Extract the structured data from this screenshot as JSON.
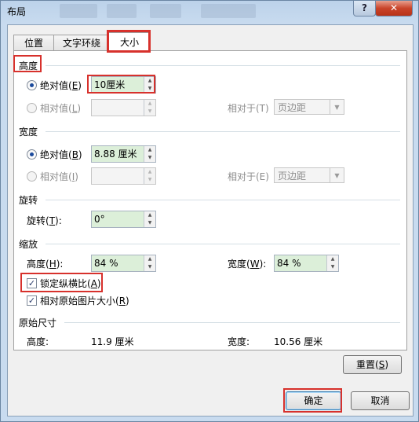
{
  "window": {
    "title": "布局",
    "help_label": "?",
    "close_label": "✕"
  },
  "tabs": [
    {
      "label": "位置",
      "active": false
    },
    {
      "label": "文字环绕",
      "active": false
    },
    {
      "label": "大小",
      "active": true
    }
  ],
  "height": {
    "section": "高度",
    "absolute_label": "绝对值(",
    "absolute_key": "E",
    "absolute_value": "10厘米",
    "relative_label": "相对值(",
    "relative_key": "L",
    "relative_to_label": "相对于(T)",
    "relative_to_value": "页边距"
  },
  "width": {
    "section": "宽度",
    "absolute_label": "绝对值(",
    "absolute_key": "B",
    "absolute_value": "8.88 厘米",
    "relative_label": "相对值(",
    "relative_key": "I",
    "relative_to_label": "相对于(E)",
    "relative_to_value": "页边距"
  },
  "rotate": {
    "section": "旋转",
    "label": "旋转(",
    "key": "T",
    "value": "0°"
  },
  "scale": {
    "section": "缩放",
    "height_label": "高度(",
    "height_key": "H",
    "height_value": "84 %",
    "width_label": "宽度(",
    "width_key": "W",
    "width_value": "84 %",
    "lock_label": "锁定纵横比(",
    "lock_key": "A",
    "lock_checked": true,
    "relative_label": "相对原始图片大小(",
    "relative_key": "R",
    "relative_checked": true
  },
  "original": {
    "section": "原始尺寸",
    "height_label": "高度:",
    "height_value": "11.9 厘米",
    "width_label": "宽度:",
    "width_value": "10.56 厘米"
  },
  "buttons": {
    "reset": "重置(",
    "reset_key": "S",
    "ok": "确定",
    "cancel": "取消"
  },
  "colors": {
    "highlight": "#d7312c",
    "value_field": "#dcefd9"
  }
}
